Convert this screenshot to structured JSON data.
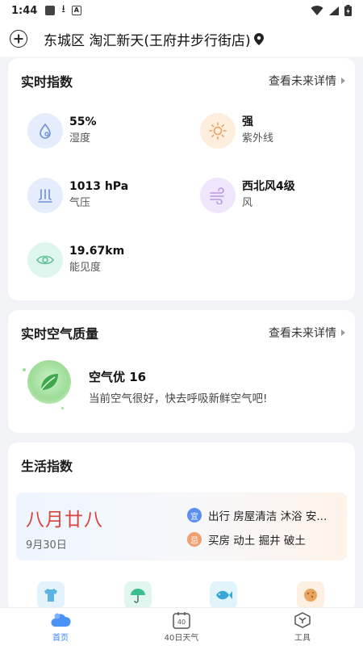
{
  "status_bar": {
    "time": "1:44"
  },
  "header": {
    "location": "东城区 淘汇新天(王府井步行街店)"
  },
  "realtime": {
    "title": "实时指数",
    "more": "查看未来详情",
    "humidity": {
      "value": "55%",
      "label": "湿度"
    },
    "uv": {
      "value": "强",
      "label": "紫外线"
    },
    "pressure": {
      "value": "1013 hPa",
      "label": "气压"
    },
    "wind": {
      "value": "西北风4级",
      "label": "风"
    },
    "visibility": {
      "value": "19.67km",
      "label": "能见度"
    }
  },
  "air": {
    "title": "实时空气质量",
    "more": "查看未来详情",
    "status": "空气优 16",
    "desc": "当前空气很好，快去呼吸新鲜空气吧!"
  },
  "life": {
    "title": "生活指数",
    "lunar": "八月廿八",
    "solar": "9月30日",
    "yi_badge": "宜",
    "yi": "出行 房屋清洁 沐浴 安...",
    "ji_badge": "忌",
    "ji": "买房 动土 掘井 破土"
  },
  "nav": {
    "home": "首页",
    "forty_icon": "40",
    "forty": "40日天气",
    "tools": "工具"
  },
  "colors": {
    "accent": "#3a86f5",
    "lunar_red": "#d9443a"
  }
}
